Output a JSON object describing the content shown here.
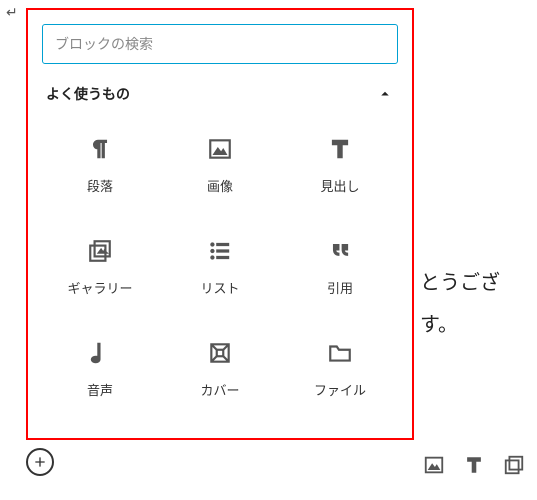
{
  "search": {
    "placeholder": "ブロックの検索"
  },
  "section": {
    "title": "よく使うもの"
  },
  "blocks": [
    {
      "label": "段落",
      "icon": "paragraph-icon"
    },
    {
      "label": "画像",
      "icon": "image-icon"
    },
    {
      "label": "見出し",
      "icon": "heading-icon"
    },
    {
      "label": "ギャラリー",
      "icon": "gallery-icon"
    },
    {
      "label": "リスト",
      "icon": "list-icon"
    },
    {
      "label": "引用",
      "icon": "quote-icon"
    },
    {
      "label": "音声",
      "icon": "audio-icon"
    },
    {
      "label": "カバー",
      "icon": "cover-icon"
    },
    {
      "label": "ファイル",
      "icon": "file-icon"
    }
  ],
  "background": {
    "line1": "とうござ",
    "line2": "す。"
  },
  "toolbar": {
    "items": [
      "image-icon",
      "heading-icon",
      "gallery-icon"
    ]
  }
}
